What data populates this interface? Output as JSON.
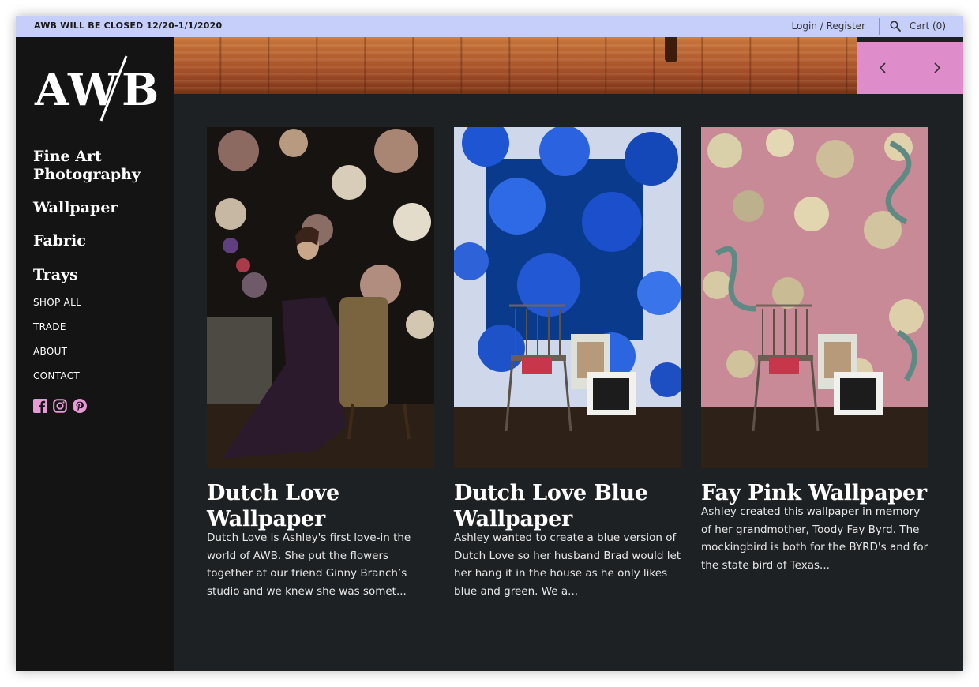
{
  "announcement": "AWB WILL BE CLOSED 12/20-1/1/2020",
  "header": {
    "login_label": "Login / Register",
    "cart_label": "Cart (0)"
  },
  "logo_text": "AWB",
  "sidebar": {
    "primary": [
      "Fine Art Photography",
      "Wallpaper",
      "Fabric",
      "Trays"
    ],
    "secondary": [
      "SHOP ALL",
      "TRADE",
      "ABOUT",
      "CONTACT"
    ],
    "social_icons": [
      "facebook-icon",
      "instagram-icon",
      "pinterest-icon"
    ]
  },
  "products": [
    {
      "title": "Dutch Love Wallpaper",
      "description": "Dutch Love is Ashley's first love-in the world of AWB.  She put the flowers together at our friend Ginny Branch’s studio and we knew she was somet..."
    },
    {
      "title": "Dutch Love Blue Wallpaper",
      "description": "Ashley wanted to create a blue version of Dutch Love so her husband Brad would let her hang it in the house as he only likes blue and green.  We a..."
    },
    {
      "title": "Fay Pink Wallpaper",
      "description": "Ashley created this wallpaper in memory of her grandmother, Toody Fay Byrd.  The mockingbird is both for the BYRD's and for the state bird of Texas..."
    }
  ],
  "colors": {
    "topbar": "#c5cffa",
    "sidebar": "#141414",
    "main_bg": "#1e2124",
    "accent_pink": "#df8ccb",
    "social_pink": "#e89ad6"
  }
}
